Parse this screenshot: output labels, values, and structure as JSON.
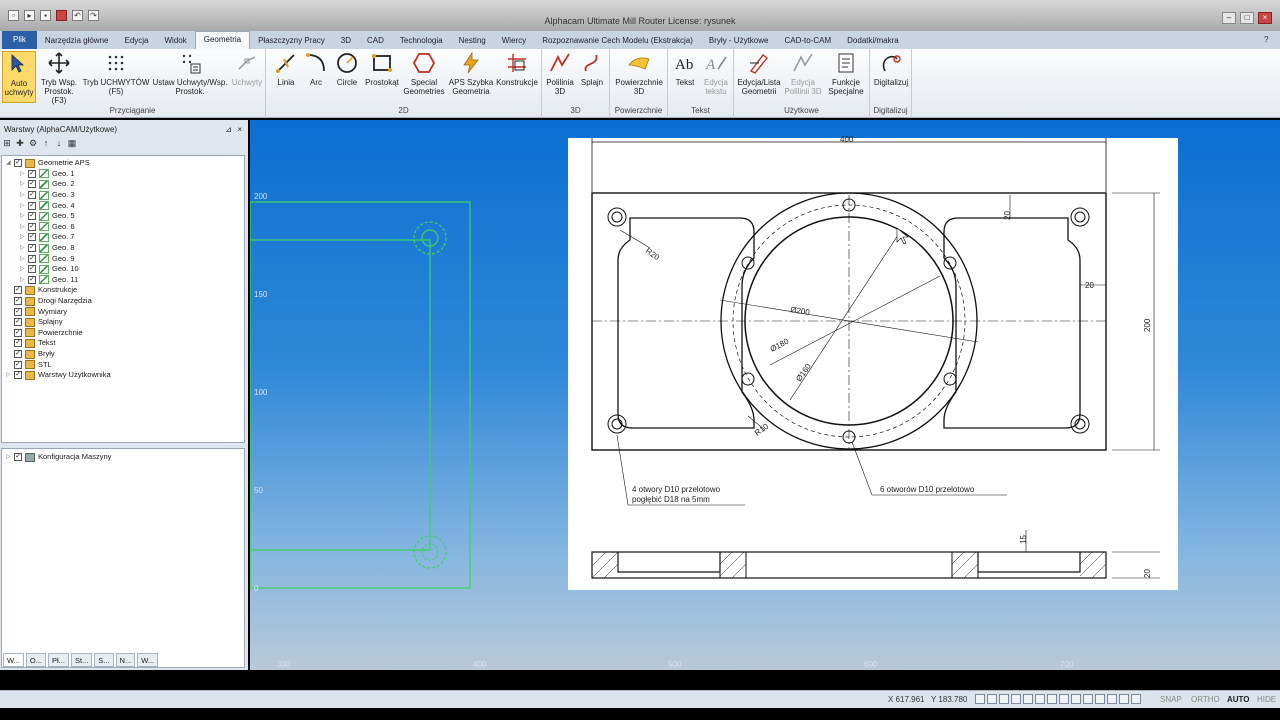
{
  "window": {
    "title": "Alphacam Ultimate Mill Router License: rysunek",
    "qat_icons": [
      "new-icon",
      "open-icon",
      "save-icon",
      "print-icon",
      "undo-icon",
      "redo-icon"
    ],
    "buttons": {
      "minimize": "–",
      "maximize": "□",
      "close": "×"
    }
  },
  "tabs": [
    {
      "label": "Plik"
    },
    {
      "label": "Narzędzia główne"
    },
    {
      "label": "Edycja"
    },
    {
      "label": "Widok"
    },
    {
      "label": "Geometria"
    },
    {
      "label": "Płaszczyzny Pracy"
    },
    {
      "label": "3D"
    },
    {
      "label": "CAD"
    },
    {
      "label": "Technologia"
    },
    {
      "label": "Nesting"
    },
    {
      "label": "Wiercy"
    },
    {
      "label": "Rozpoznawanie Cech Modelu (Ekstrakcja)"
    },
    {
      "label": "Bryły - Użytkowe"
    },
    {
      "label": "CAD-to-CAM"
    },
    {
      "label": "Dodatki/makra"
    }
  ],
  "ribbon": {
    "groups": {
      "przyciaganie": "Przyciąganie",
      "g2d": "2D",
      "g3d": "3D",
      "powierzchnie": "Powierzchnie",
      "tekst": "Tekst",
      "uzytkowe": "Użytkowe",
      "digitalizuj": "Digitalizuj"
    },
    "buttons": {
      "auto": "Auto uchwyty",
      "tryb_wsp": "Tryb Wsp. Prostok. (F3)",
      "tryb_uchwytow": "Tryb UCHWYTÓW (F5)",
      "ustaw": "Ustaw Uchwyty/Wsp. Prostok.",
      "uchwyty": "Uchwyty",
      "linia": "Linia",
      "arc": "Arc",
      "circle": "Circle",
      "prostokat": "Prostokąt",
      "special": "Special Geometries",
      "aps": "APS Szybka Geometria",
      "konstrukcje": "Konstrukcje",
      "polilinia": "Polilinia 3D",
      "splajn": "Splajn",
      "powierzchnie3d": "Powierzchnie 3D",
      "tekst": "Tekst",
      "edycja_tekstu": "Edycja tekstu",
      "edycja_lista": "Edycja/Lista Geometrii",
      "edycja_polilinii": "Edycja Polilinii 3D",
      "funkcje": "Funkcje Specjalne",
      "digitalizuj": "Digitalizuj"
    }
  },
  "layers_panel": {
    "title": "Warstwy (AlphaCAM/Użytkowe)",
    "items": [
      {
        "label": "Geometrie APS",
        "level": 0
      },
      {
        "label": "Geo. 1",
        "level": 1
      },
      {
        "label": "Geo. 2",
        "level": 1
      },
      {
        "label": "Geo. 3",
        "level": 1
      },
      {
        "label": "Geo. 4",
        "level": 1
      },
      {
        "label": "Geo. 5",
        "level": 1
      },
      {
        "label": "Geo. 6",
        "level": 1
      },
      {
        "label": "Geo. 7",
        "level": 1
      },
      {
        "label": "Geo. 8",
        "level": 1
      },
      {
        "label": "Geo. 9",
        "level": 1
      },
      {
        "label": "Geo. 10",
        "level": 1
      },
      {
        "label": "Geo. 11",
        "level": 1
      },
      {
        "label": "Konstrukcje",
        "level": 0
      },
      {
        "label": "Drogi Narzędzia",
        "level": 0
      },
      {
        "label": "Wymiary",
        "level": 0
      },
      {
        "label": "Splajny",
        "level": 0
      },
      {
        "label": "Powierzchnie",
        "level": 0
      },
      {
        "label": "Tekst",
        "level": 0
      },
      {
        "label": "Bryły",
        "level": 0
      },
      {
        "label": "STL",
        "level": 0
      },
      {
        "label": "Warstwy Użytkownika",
        "level": 0
      }
    ],
    "machine": "Konfiguracja Maszyny",
    "bottom_tabs": [
      "W...",
      "O...",
      "Pł...",
      "St...",
      "S...",
      "N...",
      "W..."
    ]
  },
  "canvas": {
    "ruler_y": [
      "200",
      "150",
      "100",
      "50",
      "0"
    ],
    "ruler_x": [
      "300",
      "400",
      "500",
      "600",
      "700"
    ],
    "drawing": {
      "dim_width": "400",
      "dim_height": "200",
      "dim_20_top": "20",
      "dim_20_right": "20",
      "r20": "R20",
      "r10": "R10",
      "d200": "Ø200",
      "d180": "Ø180",
      "d160": "Ø160",
      "note_left_1": "4  otwory  D10  przelotowo",
      "note_left_2": "pogłębić  D18  na  5mm",
      "note_right": "6  otworów  D10  przelotowo",
      "dim_15": "15",
      "dim_20_section": "20"
    }
  },
  "status": {
    "x": "X 617.961",
    "y": "Y 183.780",
    "snap": "SNAP",
    "ortho": "ORTHO",
    "auto": "AUTO",
    "hide": "HIDE"
  },
  "colors": {
    "canvas_top": "#0a6fd1",
    "geometry_green": "#2fbf4a",
    "file_tab": "#2d5fa6",
    "selected_button": "#fbd96a"
  }
}
